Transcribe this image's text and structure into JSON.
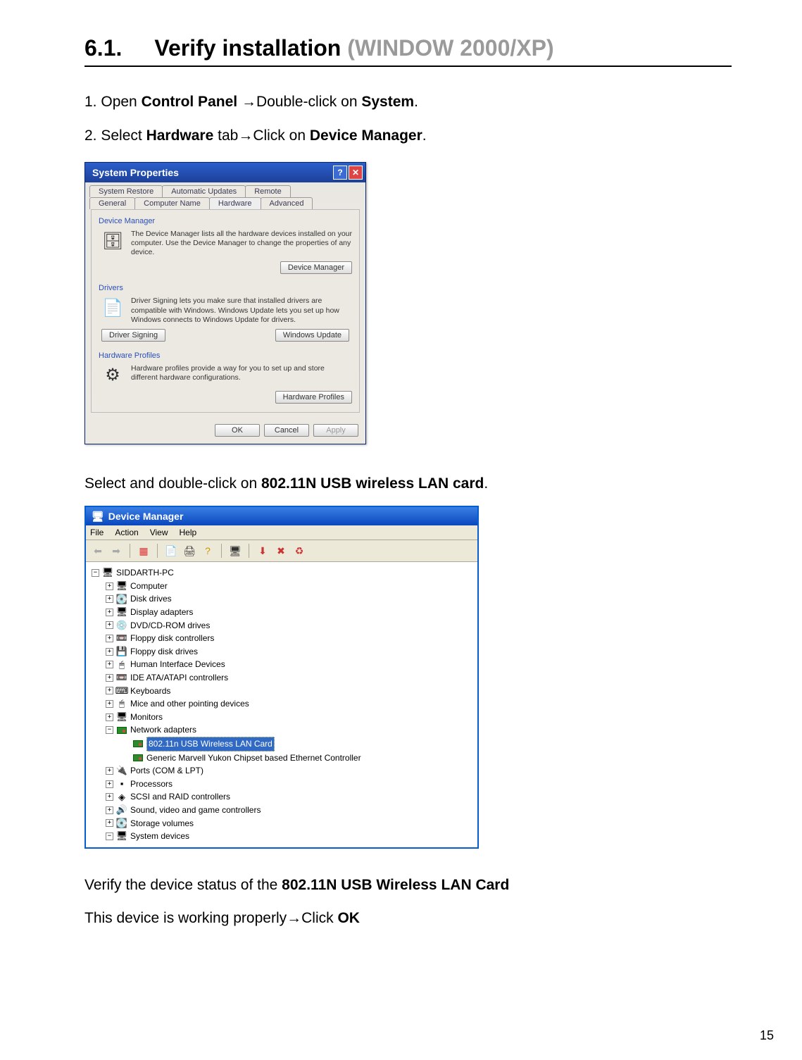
{
  "heading": {
    "number": "6.1.",
    "title_main": "Verify installation",
    "title_paren": " (WINDOW 2000/XP)"
  },
  "step1": {
    "n": "1. ",
    "a": "Open ",
    "b": "Control Panel ",
    "arrow": "→",
    "c": "Double-click on ",
    "d": "System",
    "e": "."
  },
  "step2": {
    "n": "2. ",
    "a": "Select ",
    "b": "Hardware ",
    "c": "tab",
    "arrow": "→",
    "d": "Click on ",
    "e": "Device Manager",
    "f": "."
  },
  "sysprops": {
    "title": "System Properties",
    "help": "?",
    "close": "✕",
    "tabs_row1": [
      "System Restore",
      "Automatic Updates",
      "Remote"
    ],
    "tabs_row2": [
      "General",
      "Computer Name",
      "Hardware",
      "Advanced"
    ],
    "g1_title": "Device Manager",
    "g1_text": "The Device Manager lists all the hardware devices installed on your computer. Use the Device Manager to change the properties of any device.",
    "g1_btn": "Device Manager",
    "g2_title": "Drivers",
    "g2_text": "Driver Signing lets you make sure that installed drivers are compatible with Windows. Windows Update lets you set up how Windows connects to Windows Update for drivers.",
    "g2_btn1": "Driver Signing",
    "g2_btn2": "Windows Update",
    "g3_title": "Hardware Profiles",
    "g3_text": "Hardware profiles provide a way for you to set up and store different hardware configurations.",
    "g3_btn": "Hardware Profiles",
    "ok": "OK",
    "cancel": "Cancel",
    "apply": "Apply"
  },
  "mid_text": {
    "a": "Select and double-click on ",
    "b": "802.11N USB wireless LAN card",
    "c": "."
  },
  "devmgr": {
    "title": "Device Manager",
    "menu": [
      "File",
      "Action",
      "View",
      "Help"
    ],
    "toolbar_names": [
      "back",
      "forward",
      "up-tree",
      "properties",
      "print",
      "help",
      "scan",
      "uninstall",
      "disable",
      "update-driver"
    ],
    "root": "SIDDARTH-PC",
    "nodes": [
      {
        "label": "Computer",
        "icon": "🖥",
        "e": "+"
      },
      {
        "label": "Disk drives",
        "icon": "💽",
        "e": "+"
      },
      {
        "label": "Display adapters",
        "icon": "🖥",
        "e": "+"
      },
      {
        "label": "DVD/CD-ROM drives",
        "icon": "💿",
        "e": "+"
      },
      {
        "label": "Floppy disk controllers",
        "icon": "📼",
        "e": "+"
      },
      {
        "label": "Floppy disk drives",
        "icon": "💾",
        "e": "+"
      },
      {
        "label": "Human Interface Devices",
        "icon": "🖱",
        "e": "+"
      },
      {
        "label": "IDE ATA/ATAPI controllers",
        "icon": "📼",
        "e": "+"
      },
      {
        "label": "Keyboards",
        "icon": "⌨",
        "e": "+"
      },
      {
        "label": "Mice and other pointing devices",
        "icon": "🖱",
        "e": "+"
      },
      {
        "label": "Monitors",
        "icon": "🖥",
        "e": "+"
      },
      {
        "label": "Network adapters",
        "icon": "nic",
        "e": "−",
        "children": [
          {
            "label": "802.11n USB Wireless LAN Card",
            "icon": "nic",
            "selected": true
          },
          {
            "label": "Generic Marvell Yukon Chipset based Ethernet Controller",
            "icon": "nic"
          }
        ]
      },
      {
        "label": "Ports (COM & LPT)",
        "icon": "🔌",
        "e": "+"
      },
      {
        "label": "Processors",
        "icon": "▪",
        "e": "+"
      },
      {
        "label": "SCSI and RAID controllers",
        "icon": "◈",
        "e": "+"
      },
      {
        "label": "Sound, video and game controllers",
        "icon": "🔊",
        "e": "+"
      },
      {
        "label": "Storage volumes",
        "icon": "💽",
        "e": "+"
      },
      {
        "label": "System devices",
        "icon": "🖥",
        "e": "−"
      }
    ]
  },
  "verify_text": {
    "a": "Verify the device status of the ",
    "b": "802.11N USB Wireless LAN Card"
  },
  "final_text": {
    "a": "This device is working properly",
    "arrow": "→",
    "b": "Click ",
    "c": "OK"
  },
  "page_number": "15"
}
